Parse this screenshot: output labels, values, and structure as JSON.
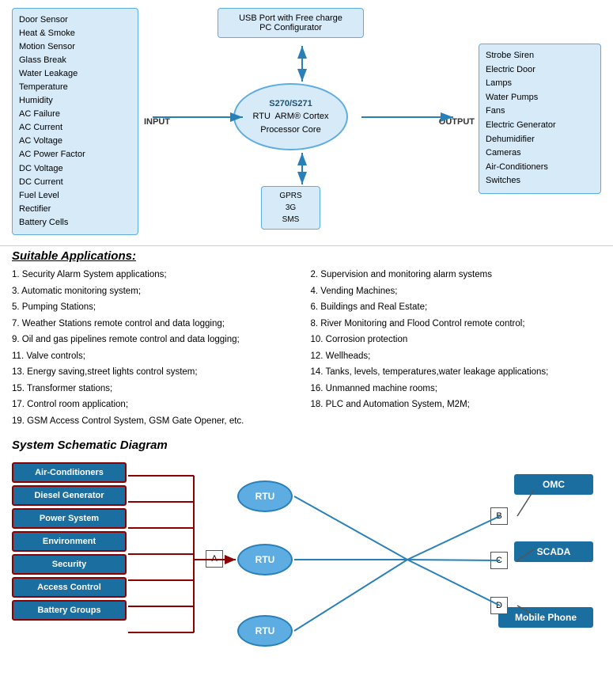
{
  "topDiagram": {
    "inputItems": [
      "Door Sensor",
      "Heat & Smoke",
      "Motion Sensor",
      "Glass Break",
      "Water Leakage",
      "Temperature",
      "Humidity",
      "AC Failure",
      "AC Current",
      "AC Voltage",
      "AC Power Factor",
      "DC Voltage",
      "DC Current",
      "Fuel Level",
      "Rectifier",
      "Battery Cells"
    ],
    "usbLabel": "USB Port with Free charge\nPC Configurator",
    "rtuTitle": "S270/S271",
    "rtuSubtitle": "RTU  ARM® Cortex\nProcessor Core",
    "commItems": [
      "GPRS",
      "3G",
      "SMS"
    ],
    "inputLabel": "INPUT",
    "outputLabel": "OUTPUT",
    "outputItems": [
      "Strobe Siren",
      "Electric Door",
      "Lamps",
      "Water Pumps",
      "Fans",
      "Electric Generator",
      "Dehumidifier",
      "Cameras",
      "Air-Conditioners",
      "Switches"
    ]
  },
  "applications": {
    "heading": "Suitable Applications:",
    "items": [
      "1. Security Alarm System applications;",
      "2. Supervision and monitoring alarm systems",
      "3. Automatic monitoring system;",
      "4. Vending Machines;",
      "5. Pumping Stations;",
      "6. Buildings and Real Estate;",
      "7. Weather Stations remote control and data logging;",
      "8. River Monitoring and Flood Control remote control;",
      "9. Oil and gas pipelines remote control and data logging;",
      "10. Corrosion protection",
      "11. Valve controls;",
      "12. Wellheads;",
      "13. Energy saving,street lights control system;",
      "14. Tanks, levels, temperatures,water leakage applications;",
      "15. Transformer stations;",
      "16. Unmanned machine rooms;",
      "17. Control room application;",
      "18. PLC and Automation System, M2M;",
      "19. GSM Access Control System, GSM Gate Opener, etc.",
      ""
    ]
  },
  "schematic": {
    "heading": "System Schematic Diagram",
    "leftBoxes": [
      "Air-Conditioners",
      "Diesel Generator",
      "Power System",
      "Environment",
      "Security",
      "Access Control",
      "Battery Groups"
    ],
    "rtuLabels": [
      "RTU",
      "RTU",
      "RTU"
    ],
    "rightBoxes": [
      "OMC",
      "SCADA",
      "Mobile Phone"
    ],
    "letters": [
      "A",
      "B",
      "C",
      "D"
    ]
  }
}
